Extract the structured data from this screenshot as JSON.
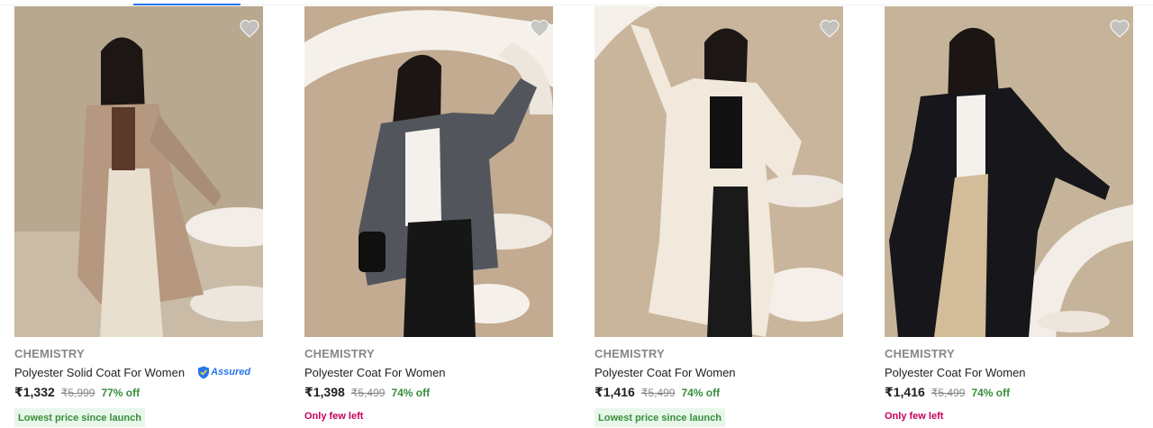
{
  "colors": {
    "accent": "#2874f0",
    "offer_green": "#388e3c",
    "badge_bg": "#e7f7ea",
    "alert_red": "#c70055",
    "muted": "#878787"
  },
  "products": [
    {
      "brand": "CHEMISTRY",
      "title": "Polyester Solid Coat For Women",
      "assured_label": "Assured",
      "price": "₹1,332",
      "mrp": "₹5,999",
      "discount": "77% off",
      "badge": "Lowest price since launch",
      "coat_color": "#b79a83",
      "wishlist_icon": "heart-icon"
    },
    {
      "brand": "CHEMISTRY",
      "title": "Polyester Coat For Women",
      "price": "₹1,398",
      "mrp": "₹5,499",
      "discount": "74% off",
      "alert": "Only few left",
      "coat_color": "#5a5d63",
      "wishlist_icon": "heart-icon"
    },
    {
      "brand": "CHEMISTRY",
      "title": "Polyester Coat For Women",
      "price": "₹1,416",
      "mrp": "₹5,499",
      "discount": "74% off",
      "badge": "Lowest price since launch",
      "coat_color": "#f3ece2",
      "wishlist_icon": "heart-icon"
    },
    {
      "brand": "CHEMISTRY",
      "title": "Polyester Coat For Women",
      "price": "₹1,416",
      "mrp": "₹5,499",
      "discount": "74% off",
      "alert": "Only few left",
      "coat_color": "#15151a",
      "wishlist_icon": "heart-icon"
    }
  ]
}
